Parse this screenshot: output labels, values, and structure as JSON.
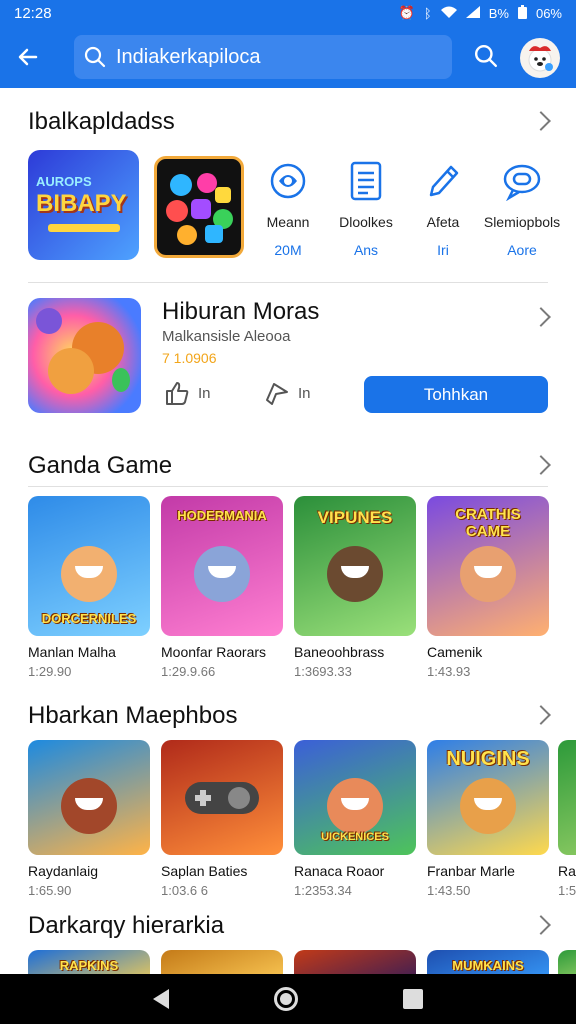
{
  "status_bar": {
    "time": "12:28",
    "battery_left": "B%",
    "battery_right": "06%"
  },
  "search": {
    "query": "Indiakerkapiloca"
  },
  "sections": [
    {
      "title": "Ibalkapldadss",
      "apps": [
        {
          "name": "Meann",
          "meta": "20M",
          "icon": "ai-shield-icon"
        },
        {
          "name": "Dloolkes",
          "meta": "Ans",
          "icon": "document-icon"
        },
        {
          "name": "Afeta",
          "meta": "Iri",
          "icon": "pen-icon"
        },
        {
          "name": "Slemiopbols",
          "meta": "Aore",
          "icon": "chat-icon"
        }
      ],
      "tiles": [
        {
          "label": "BIBAPY",
          "label_top": "AUROPS"
        }
      ]
    },
    {
      "title": "Hiburan Moras",
      "subtitle": "Malkansisle Aleooa",
      "rating": "7 1.0906",
      "actions": [
        {
          "label": "In",
          "icon": "thumbs-up-icon"
        },
        {
          "label": "In",
          "icon": "share-icon"
        }
      ],
      "cta": "Tohhkan"
    },
    {
      "title": "Ganda Game",
      "cards": [
        {
          "title": "Manlan Malha",
          "meta": "1:29.90",
          "art_label": "DORCERNILES",
          "colors": [
            "#2e8be8",
            "#7ed0ff"
          ]
        },
        {
          "title": "Moonfar Raorars",
          "meta": "1:29.9.66",
          "art_label": "HODERMANIA",
          "colors": [
            "#c23aa8",
            "#ff7fd1"
          ]
        },
        {
          "title": "Baneoohbrass",
          "meta": "1:3693.33",
          "art_label": "VIPUNES",
          "colors": [
            "#2b8f3a",
            "#9ae07a"
          ]
        },
        {
          "title": "Camenik",
          "meta": "1:43.93",
          "art_label": "CRATHIS CAME",
          "colors": [
            "#7a4ae0",
            "#ffb070"
          ]
        }
      ]
    },
    {
      "title": "Hbarkan Maephbos",
      "cards": [
        {
          "title": "Raydanlaig",
          "meta": "1:65.90",
          "art_label": "",
          "colors": [
            "#1d8ae0",
            "#ffb347"
          ]
        },
        {
          "title": "Saplan Baties",
          "meta": "1:03.6 6",
          "art_label": "",
          "colors": [
            "#b02a1a",
            "#ff8f3a"
          ]
        },
        {
          "title": "Ranaca Roaor",
          "meta": "1:2353.34",
          "art_label": "UICKENICES",
          "colors": [
            "#3b5fd8",
            "#4ec45a"
          ]
        },
        {
          "title": "Franbar Marle",
          "meta": "1:43.50",
          "art_label": "NUIGINS",
          "colors": [
            "#2e7ee8",
            "#ffd94d"
          ]
        },
        {
          "title": "Ra",
          "meta": "1:5",
          "art_label": "",
          "colors": [
            "#2d9a3a",
            "#9ed36a"
          ]
        }
      ]
    },
    {
      "title": "Darkarqy hierarkia",
      "cards": [
        {
          "art_label": "RAPKINS",
          "colors": [
            "#1d6ed8",
            "#ffd34d"
          ]
        },
        {
          "art_label": "",
          "colors": [
            "#c47a18",
            "#ffcf5a"
          ]
        },
        {
          "art_label": "",
          "colors": [
            "#c23a18",
            "#2e1a5a"
          ]
        },
        {
          "art_label": "MUMKAINS",
          "colors": [
            "#1e4fb0",
            "#39a0ff"
          ]
        },
        {
          "art_label": "",
          "colors": [
            "#2d9a3a",
            "#9ed36a"
          ]
        }
      ]
    }
  ],
  "navbar": {
    "back": "back-icon",
    "home": "home-icon",
    "recents": "recents-icon"
  }
}
